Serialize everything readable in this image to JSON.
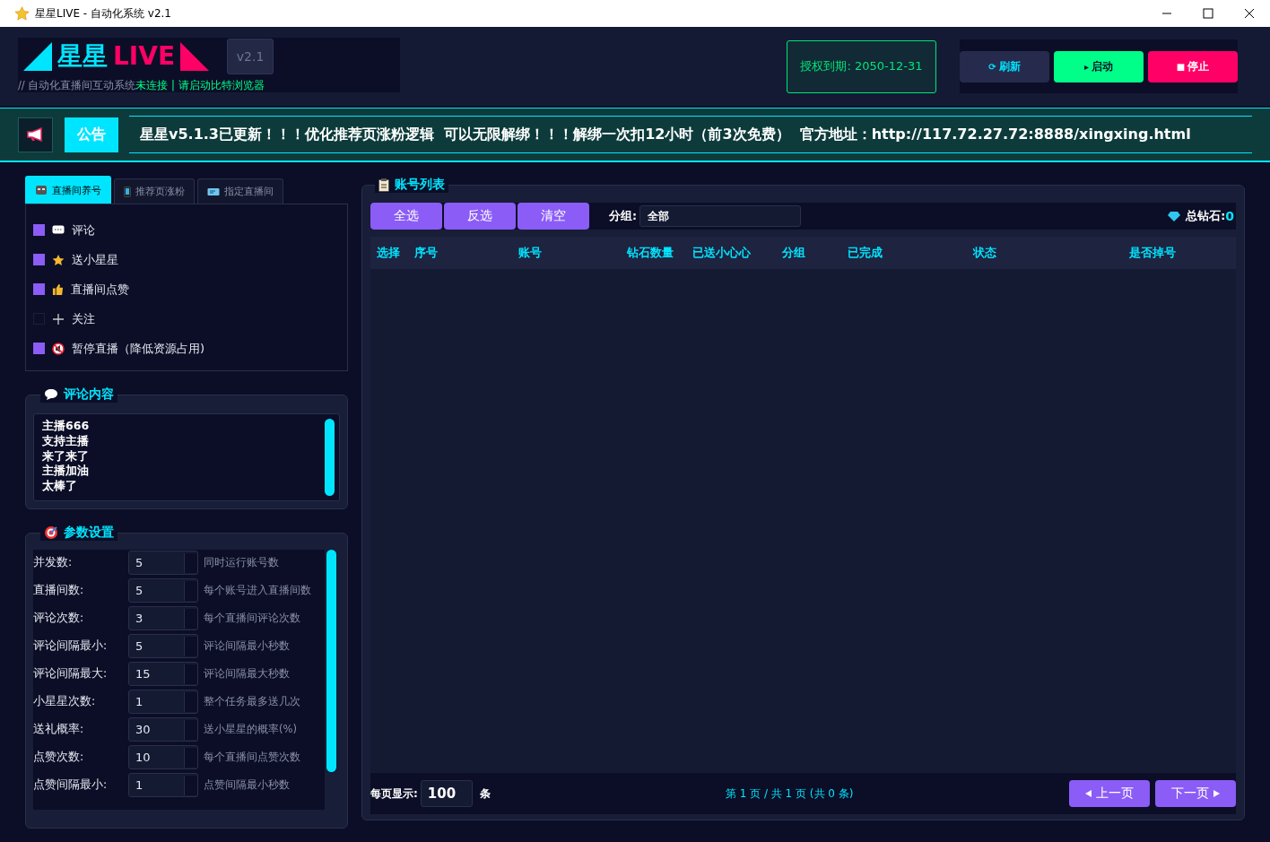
{
  "window": {
    "title": "星星LIVE - 自动化系统 v2.1"
  },
  "header": {
    "logo_left": "星星",
    "logo_right": "LIVE",
    "version": "v2.1",
    "subtitle": "// 自动化直播间互动系统",
    "status": "未连接 | 请启动比特浏览器",
    "license": "授权到期: 2050-12-31",
    "buttons": [
      {
        "kind": "refresh",
        "icon": "⟳",
        "label": "刷新"
      },
      {
        "kind": "start",
        "icon": "▸",
        "label": "启动"
      },
      {
        "kind": "stop",
        "icon": "■",
        "label": "停止"
      }
    ]
  },
  "notice": {
    "badge": "公告",
    "text": "星星v5.1.3已更新！！！优化推荐页涨粉逻辑  可以无限解绑！！！解绑一次扣12小时（前3次免费）  官方地址：http://117.72.27.72:8888/xingxing.html"
  },
  "tabs": [
    {
      "label": "直播间养号",
      "selected": true
    },
    {
      "label": "推荐页涨粉",
      "selected": false
    },
    {
      "label": "指定直播间",
      "selected": false
    }
  ],
  "options": [
    {
      "label": "评论",
      "checked": true
    },
    {
      "label": "送小星星",
      "checked": true
    },
    {
      "label": "直播间点赞",
      "checked": true
    },
    {
      "label": "关注",
      "checked": false
    },
    {
      "label": "暂停直播（降低资源占用)",
      "checked": true
    }
  ],
  "comments": {
    "title": "评论内容",
    "lines": [
      "主播666",
      "支持主播",
      "来了来了",
      "主播加油",
      "太棒了"
    ]
  },
  "params": {
    "title": "参数设置",
    "rows": [
      {
        "label": "并发数:",
        "value": "5",
        "hint": "同时运行账号数"
      },
      {
        "label": "直播间数:",
        "value": "5",
        "hint": "每个账号进入直播间数"
      },
      {
        "label": "评论次数:",
        "value": "3",
        "hint": "每个直播间评论次数"
      },
      {
        "label": "评论间隔最小:",
        "value": "5",
        "hint": "评论间隔最小秒数"
      },
      {
        "label": "评论间隔最大:",
        "value": "15",
        "hint": "评论间隔最大秒数"
      },
      {
        "label": "小星星次数:",
        "value": "1",
        "hint": "整个任务最多送几次"
      },
      {
        "label": "送礼概率:",
        "value": "30",
        "hint": "送小星星的概率(%)"
      },
      {
        "label": "点赞次数:",
        "value": "10",
        "hint": "每个直播间点赞次数"
      },
      {
        "label": "点赞间隔最小:",
        "value": "1",
        "hint": "点赞间隔最小秒数"
      }
    ]
  },
  "accounts": {
    "title": "账号列表",
    "actions": [
      "全选",
      "反选",
      "清空"
    ],
    "group_label": "分组:",
    "group_value": "全部",
    "total_label": "总钻石:",
    "total_value": "0",
    "columns": [
      "选择",
      "序号",
      "账号",
      "钻石数量",
      "已送小心心",
      "分组",
      "已完成",
      "状态",
      "是否掉号"
    ],
    "page_size_label": "每页显示:",
    "page_size": "100",
    "page_size_unit": "条",
    "page_info": "第 1 页 / 共 1 页 (共 0 条)",
    "prev": "上一页",
    "next": "下一页"
  }
}
